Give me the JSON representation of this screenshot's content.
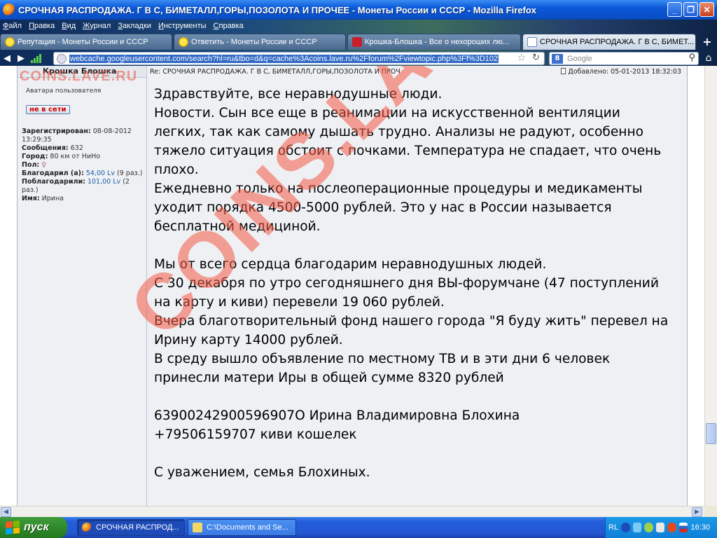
{
  "window": {
    "title": "СРОЧНАЯ РАСПРОДАЖА. Г В С, БИМЕТАЛЛ,ГОРЫ,ПОЗОЛОТА И ПРОЧЕЕ - Монеты России и СССР - Mozilla Firefox",
    "minimize": "_",
    "maximize": "❐",
    "close": "✕"
  },
  "menu": [
    "Файл",
    "Правка",
    "Вид",
    "Журнал",
    "Закладки",
    "Инструменты",
    "Справка"
  ],
  "tabs": [
    {
      "label": "Репутация - Монеты России и СССР",
      "icon": "smiley-icon"
    },
    {
      "label": "Ответить - Монеты России и СССР",
      "icon": "smiley-icon"
    },
    {
      "label": "Крошка-Блошка - Все о нехороших лю...",
      "icon": "hammer-sickle-icon"
    },
    {
      "label": "СРОЧНАЯ РАСПРОДАЖА. Г В С, БИМЕТ...",
      "icon": "google-icon"
    }
  ],
  "nav": {
    "url": "webcache.googleusercontent.com/search?hl=ru&tbo=d&q=cache%3Acoins.lave.ru%2Fforum%2Fviewtopic.php%3Ff%3D102",
    "search_placeholder": "Google"
  },
  "watermark": {
    "top": "COINS.LAVE.RU",
    "diagonal": "COINS.LAVE.RU"
  },
  "author": {
    "name": "Крошка Блошка",
    "avatar_text": "Аватара пользователя",
    "status": "не в сети",
    "registered_label": "Зарегистрирован:",
    "registered_value": "08-08-2012 13:29:35",
    "messages_label": "Сообщения:",
    "messages_value": "632",
    "city_label": "Город:",
    "city_value": "80 км от НиНо",
    "gender_label": "Пол:",
    "thanked_label": "Благодарил (а):",
    "thanked_value": "54,00 Lv",
    "thanked_times": "(9 раз.)",
    "was_thanked_label": "Поблагодарили:",
    "was_thanked_value": "101,00 Lv",
    "was_thanked_times": "(2 раз.)",
    "name_label": "Имя:",
    "name_value": "Ирина"
  },
  "post": {
    "subject": "Re: СРОЧНАЯ РАСПРОДАЖА. Г В С, БИМЕТАЛЛ,ГОРЫ,ПОЗОЛОТА И ПРОЧ",
    "date": "Добавлено: 05-01-2013 18:32:03",
    "lines": [
      "Здравствуйте, все неравнодушные люди.",
      "Новости. Сын все еще в реанимации на искусственной вентиляции",
      "легких, так как самому дышать трудно. Анализы не радуют, особенно",
      "тяжело ситуация обстоит с почками. Температура не спадает, что очень",
      "плохо.",
      "Ежедневно только на послеоперационные процедуры и медикаменты",
      "уходит порядка 4500-5000 рублей. Это у нас в России называется",
      "бесплатной медициной.",
      "",
      "Мы от всего сердца благодарим неравнодушных людей.",
      "С 30 декабря по утро сегодняшнего дня ВЫ-форумчане (47 поступлений",
      "на карту и киви) перевели 19 060 рублей.",
      "Вчера благотворительный фонд нашего города \"Я буду жить\" перевел на",
      "Ирину карту 14000 рублей.",
      "В среду вышло объявление по местному ТВ и в эти дни 6 человек",
      "принесли матери Иры в общей сумме 8320 рублей",
      "",
      "63900242900596907О Ирина Владимировна Блохина",
      "+79506159707 киви кошелек",
      "",
      "С уважением, семья Блохиных."
    ]
  },
  "taskbar": {
    "start": "пуск",
    "items": [
      {
        "label": "СРОЧНАЯ РАСПРОД...",
        "active": true
      },
      {
        "label": "C:\\Documents and Se...",
        "active": false
      }
    ],
    "lang": "RL",
    "clock": "16:30"
  }
}
